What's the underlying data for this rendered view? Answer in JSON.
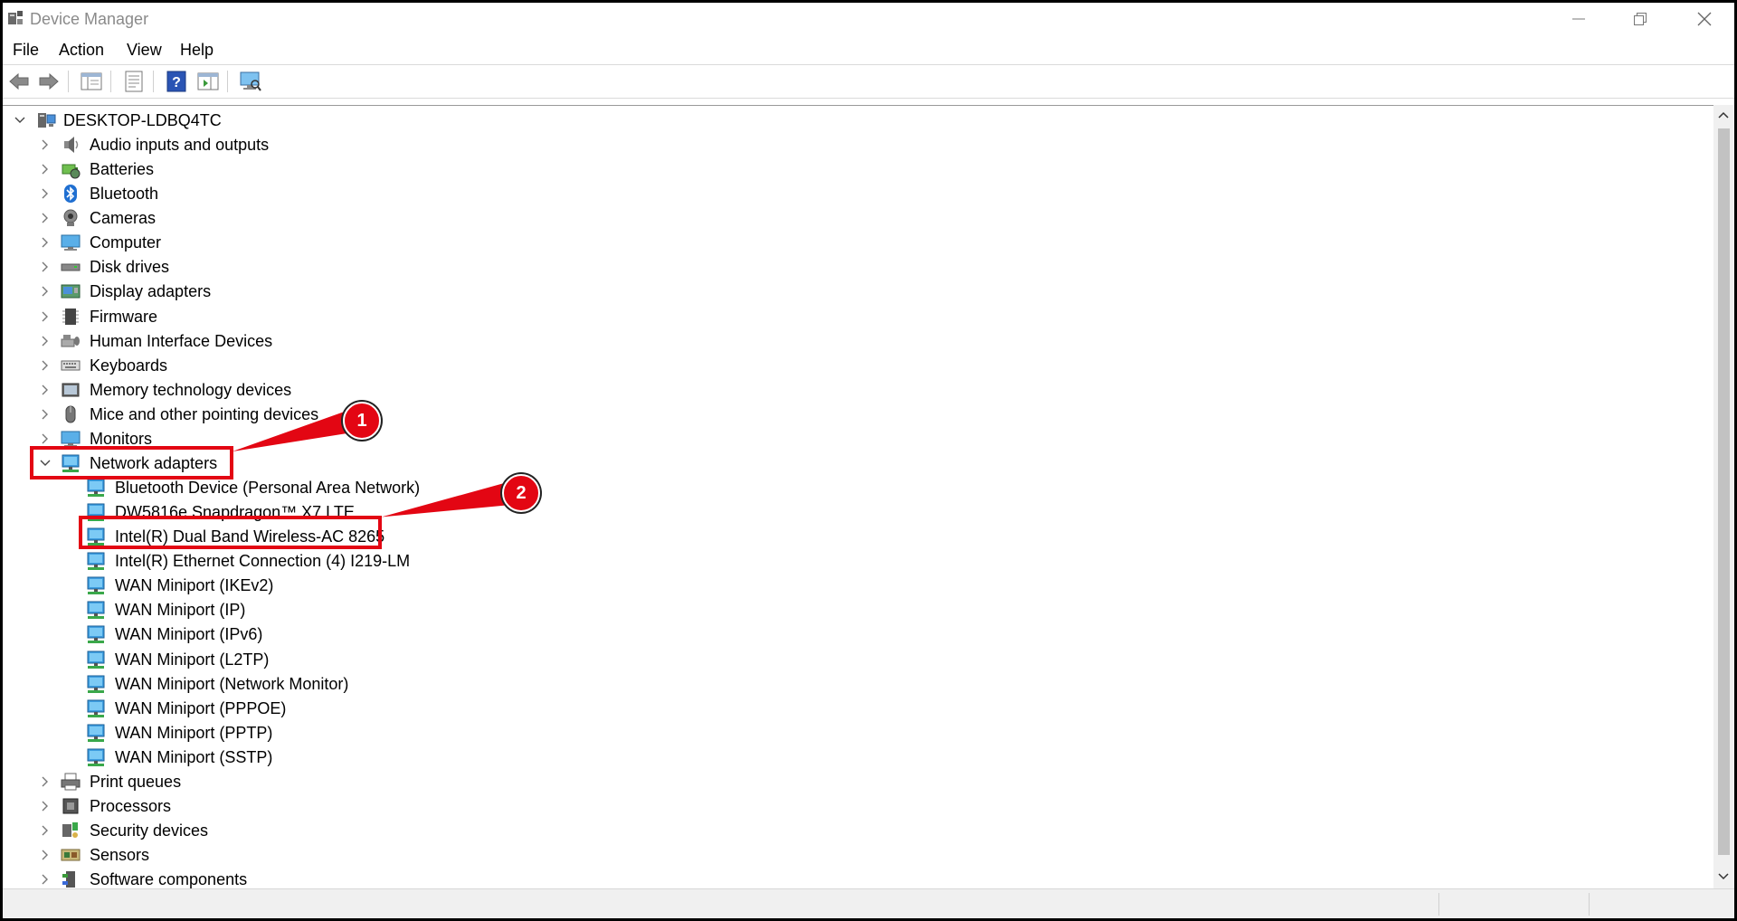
{
  "window": {
    "title": "Device Manager"
  },
  "menu": [
    "File",
    "Action",
    "View",
    "Help"
  ],
  "toolbar": {
    "icons": [
      "back-arrow-icon",
      "forward-arrow-icon",
      "console-tree-icon",
      "properties-icon",
      "help-icon",
      "action-pane-icon",
      "scan-hardware-icon"
    ]
  },
  "tree": {
    "root": "DESKTOP-LDBQ4TC",
    "categories": [
      {
        "label": "Audio inputs and outputs",
        "icon": "speaker-icon"
      },
      {
        "label": "Batteries",
        "icon": "battery-icon"
      },
      {
        "label": "Bluetooth",
        "icon": "bluetooth-icon"
      },
      {
        "label": "Cameras",
        "icon": "camera-icon"
      },
      {
        "label": "Computer",
        "icon": "monitor-icon"
      },
      {
        "label": "Disk drives",
        "icon": "disk-drive-icon"
      },
      {
        "label": "Display adapters",
        "icon": "display-adapter-icon"
      },
      {
        "label": "Firmware",
        "icon": "chip-icon"
      },
      {
        "label": "Human Interface Devices",
        "icon": "hid-icon"
      },
      {
        "label": "Keyboards",
        "icon": "keyboard-icon"
      },
      {
        "label": "Memory technology devices",
        "icon": "memory-icon"
      },
      {
        "label": "Mice and other pointing devices",
        "icon": "mouse-icon"
      },
      {
        "label": "Monitors",
        "icon": "monitor-icon"
      },
      {
        "label": "Network adapters",
        "icon": "network-adapter-icon",
        "expanded": true
      },
      {
        "label": "Print queues",
        "icon": "printer-icon"
      },
      {
        "label": "Processors",
        "icon": "processor-icon"
      },
      {
        "label": "Security devices",
        "icon": "security-device-icon"
      },
      {
        "label": "Sensors",
        "icon": "sensor-icon"
      },
      {
        "label": "Software components",
        "icon": "software-component-icon"
      }
    ],
    "network_adapters": [
      "Bluetooth Device (Personal Area Network)",
      "DW5816e Snapdragon™ X7 LTE",
      "Intel(R) Dual Band Wireless-AC 8265",
      "Intel(R) Ethernet Connection (4) I219-LM",
      "WAN Miniport (IKEv2)",
      "WAN Miniport (IP)",
      "WAN Miniport (IPv6)",
      "WAN Miniport (L2TP)",
      "WAN Miniport (Network Monitor)",
      "WAN Miniport (PPPOE)",
      "WAN Miniport (PPTP)",
      "WAN Miniport (SSTP)"
    ]
  },
  "annotations": [
    {
      "number": "1",
      "target": "Network adapters"
    },
    {
      "number": "2",
      "target": "Intel(R) Dual Band Wireless-AC 8265"
    }
  ],
  "colors": {
    "highlight": "#e30613",
    "adapter_blue": "#2f8fd8"
  }
}
